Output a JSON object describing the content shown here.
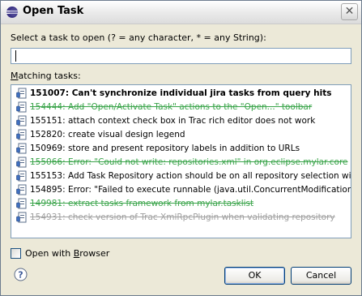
{
  "window": {
    "title": "Open Task",
    "close_glyph": "✕"
  },
  "prompt": {
    "label": "Select a task to open (? = any character, * = any String):"
  },
  "search": {
    "value": "",
    "placeholder": ""
  },
  "matching": {
    "label_prefix": "",
    "label_u": "M",
    "label_rest": "atching tasks:"
  },
  "tasks": [
    {
      "text": "151007: Can't synchronize individual jira tasks from query hits",
      "style": "bold",
      "icon": "task-icon"
    },
    {
      "text": "154444: Add \"Open/Activate Task\" actions to the \"Open...\" toolbar",
      "style": "done",
      "icon": "task-icon"
    },
    {
      "text": "155151: attach context check box in Trac rich editor does not work",
      "style": "normal",
      "icon": "task-icon"
    },
    {
      "text": "152820: create visual design legend",
      "style": "normal",
      "icon": "task-icon"
    },
    {
      "text": "150969: store and present repository labels in addition to URLs",
      "style": "normal",
      "icon": "task-icon"
    },
    {
      "text": "155066: Error: \"Could not write: repositories.xml\" in org.eclipse.mylar.core",
      "style": "done",
      "icon": "task-icon"
    },
    {
      "text": "155153: Add Task Repository action should be on all repository selection wizard pa",
      "style": "normal",
      "icon": "task-icon"
    },
    {
      "text": "154895: Error: \"Failed to execute runnable (java.util.ConcurrentModificationExcep",
      "style": "normal",
      "icon": "task-icon"
    },
    {
      "text": "149981: extract tasks framework from mylar.tasklist",
      "style": "done",
      "icon": "task-icon"
    },
    {
      "text": "154931: check version of Trac XmlRpcPlugin when validating repository",
      "style": "done gray",
      "icon": "task-icon"
    }
  ],
  "options": {
    "browser_prefix": "Open with ",
    "browser_u": "B",
    "browser_rest": "rowser",
    "checked": false
  },
  "buttons": {
    "ok": "OK",
    "cancel": "Cancel"
  },
  "colors": {
    "done_text": "#3aa44a",
    "done_gray": "#a0a0a0",
    "input_border": "#7f9db9",
    "button_border": "#003c74"
  }
}
